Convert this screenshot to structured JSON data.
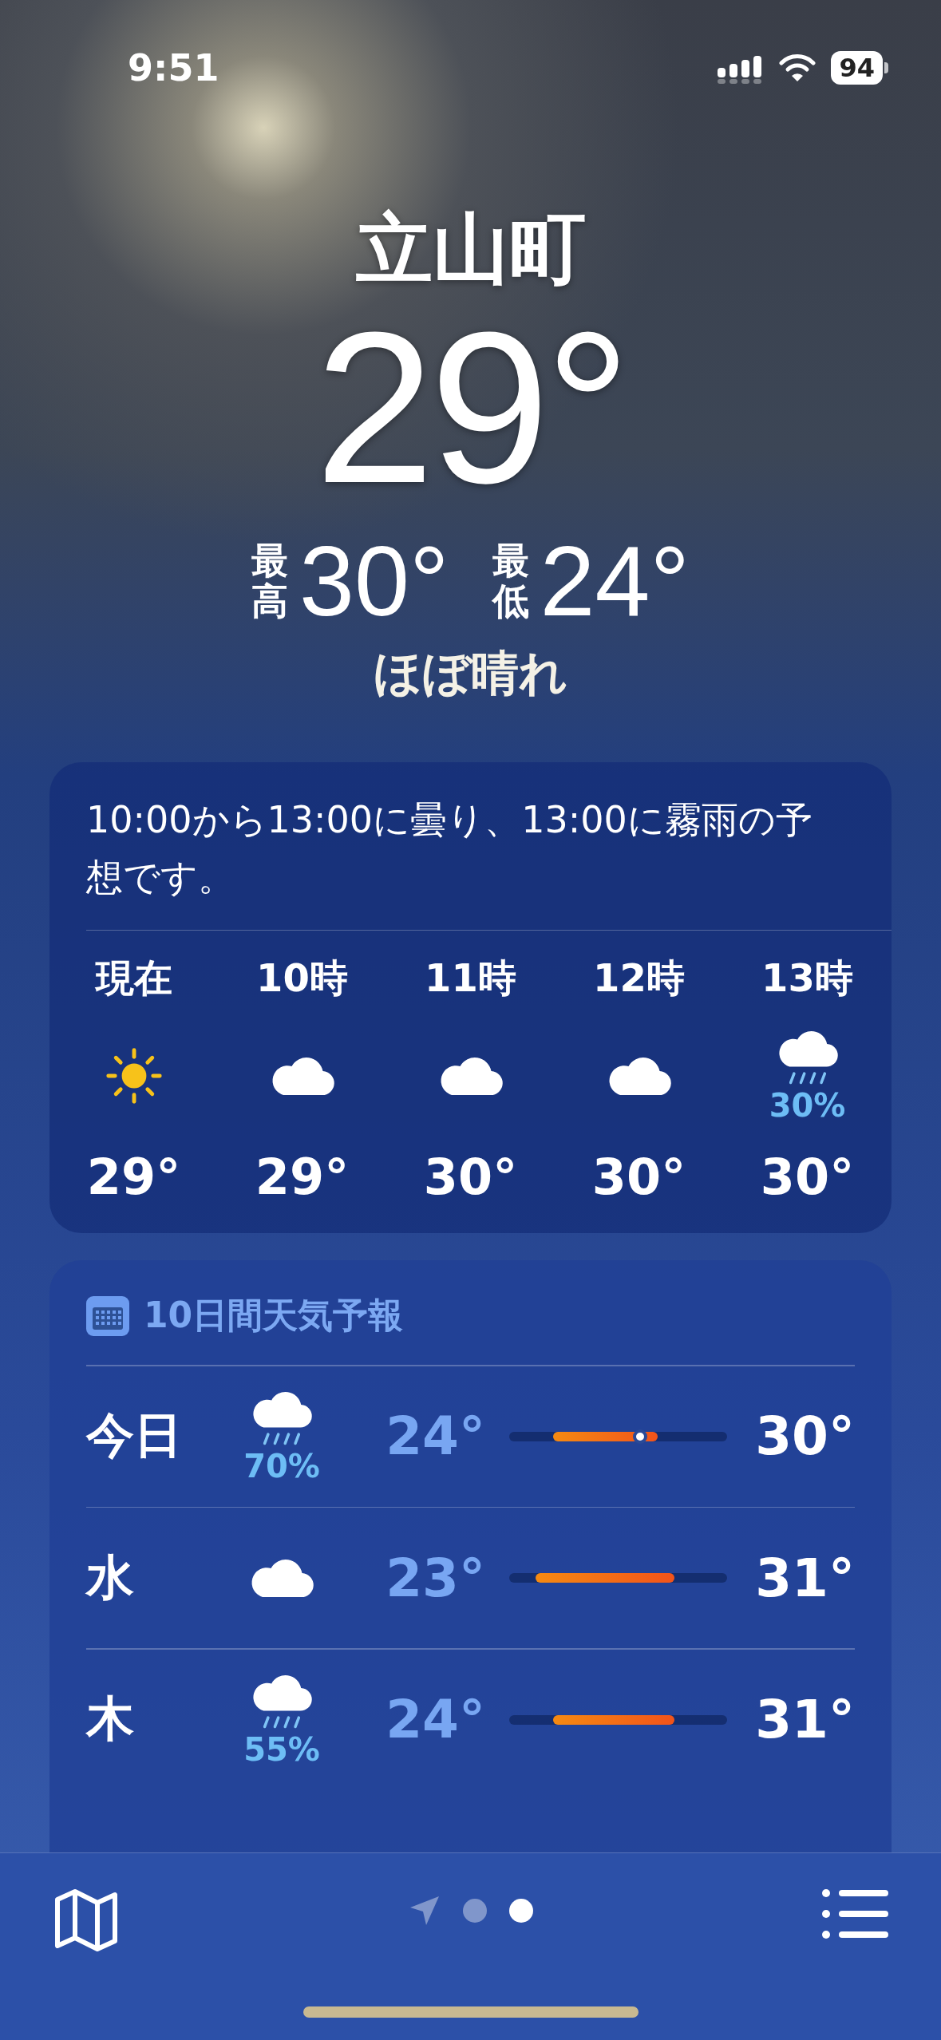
{
  "status_bar": {
    "time": "9:51",
    "battery": "94"
  },
  "location": {
    "name": "立山町",
    "temperature": "29°",
    "high_label": "最高",
    "high": "30°",
    "low_label": "最低",
    "low": "24°",
    "condition": "ほぼ晴れ"
  },
  "hourly": {
    "summary": "10:00から13:00に曇り、13:00に霧雨の予想です。",
    "hours": [
      {
        "label": "現在",
        "kind": "sun",
        "temperature": "29°"
      },
      {
        "label": "10時",
        "kind": "cloud",
        "temperature": "29°"
      },
      {
        "label": "11時",
        "kind": "cloud",
        "temperature": "30°"
      },
      {
        "label": "12時",
        "kind": "cloud",
        "temperature": "30°"
      },
      {
        "label": "13時",
        "kind": "rain",
        "precipitation": "30%",
        "temperature": "30°"
      }
    ]
  },
  "daily": {
    "title": "10日間天気予報",
    "days": [
      {
        "day": "今日",
        "kind": "rain",
        "precipitation": "70%",
        "low": "24°",
        "high": "30°",
        "current": true
      },
      {
        "day": "水",
        "kind": "cloud",
        "low": "23°",
        "high": "31°",
        "current": false
      },
      {
        "day": "木",
        "kind": "rain",
        "precipitation": "55%",
        "low": "24°",
        "high": "31°",
        "current": false
      }
    ]
  },
  "pages": [
    {
      "kind": "location",
      "selected": false
    },
    {
      "kind": "dot",
      "selected": false
    },
    {
      "kind": "dot",
      "selected": true
    }
  ]
}
